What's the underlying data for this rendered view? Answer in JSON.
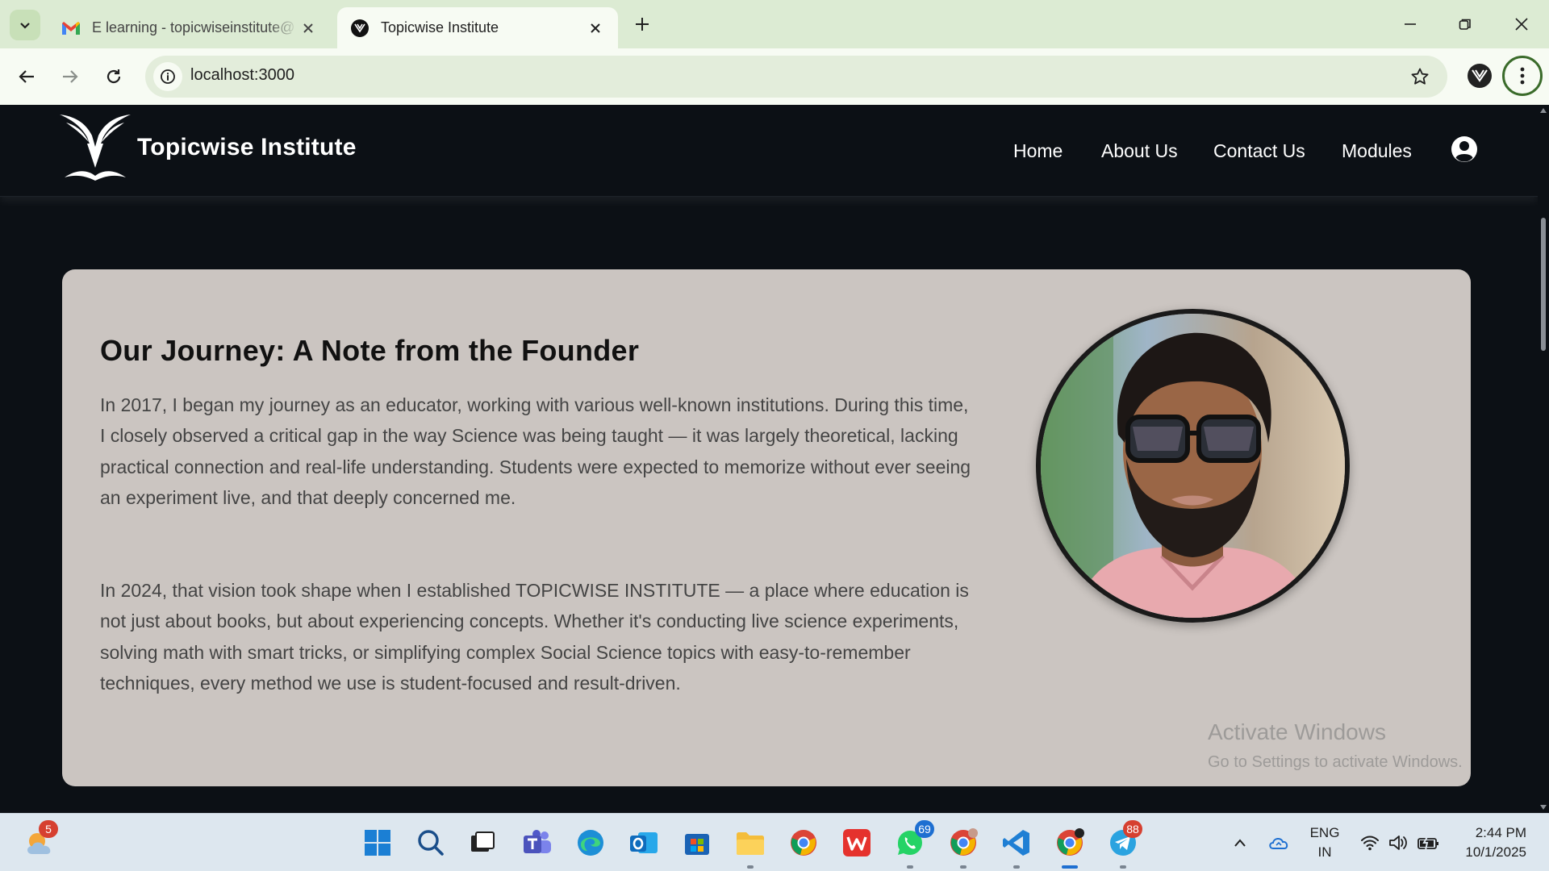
{
  "browser": {
    "tabs": [
      {
        "title": "E learning - topicwiseinstitute@",
        "favicon": "gmail-icon",
        "active": false
      },
      {
        "title": "Topicwise Institute",
        "favicon": "topicwise-logo-icon",
        "active": true
      }
    ],
    "url": "localhost:3000"
  },
  "site": {
    "brand": "Topicwise Institute",
    "nav": [
      "Home",
      "About Us",
      "Contact Us",
      "Modules"
    ]
  },
  "founder": {
    "heading": "Our Journey: A Note from the Founder",
    "paragraph1": "In 2017, I began my journey as an educator, working with various well-known institutions. During this time, I closely observed a critical gap in the way Science was being taught — it was largely theoretical, lacking practical connection and real-life understanding. Students were expected to memorize without ever seeing an experiment live, and that deeply concerned me.",
    "paragraph2": "In 2024, that vision took shape when I established TOPICWISE INSTITUTE — a place where education is not just about books, but about experiencing concepts. Whether it's conducting live science experiments, solving math with smart tricks, or simplifying complex Social Science topics with easy-to-remember techniques, every method we use is student-focused and result-driven."
  },
  "watermark": {
    "line1": "Activate Windows",
    "line2": "Go to Settings to activate Windows."
  },
  "taskbar": {
    "weather_badge": "5",
    "whatsapp_badge": "69",
    "telegram_badge": "88",
    "lang_line1": "ENG",
    "lang_line2": "IN",
    "time": "2:44 PM",
    "date": "10/1/2025"
  },
  "colors": {
    "page_bg": "#0c1015",
    "card_bg": "#cbc5c1",
    "chrome_bg": "#dcebd3"
  }
}
